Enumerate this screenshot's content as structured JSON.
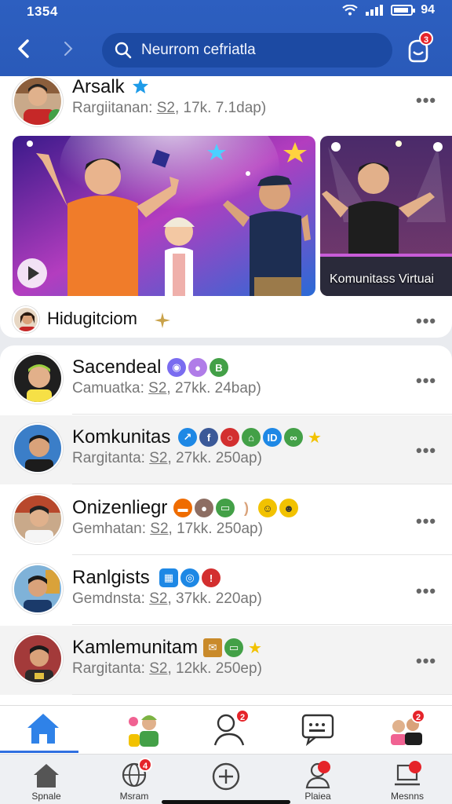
{
  "status": {
    "time": "1354",
    "battery": "94"
  },
  "header": {
    "search_text": "Neurrom cefriatla",
    "notif_count": "3"
  },
  "feed": {
    "title": "Arsalk",
    "meta_prefix": "Rargiitanan:",
    "meta_link": "S2",
    "meta_suffix": ", 17k. 7.1dap)",
    "caption2": "Komunitass Virtuai",
    "group_label": "Hidugitciom"
  },
  "list": [
    {
      "name": "Sacendeal",
      "prefix": "Camuatka:",
      "link": "S2",
      "suffix": ", 27kk. 24bap)"
    },
    {
      "name": "Komkunitas",
      "prefix": "Rargitanta:",
      "link": "S2",
      "suffix": ", 27kk. 250ap)"
    },
    {
      "name": "Onizenliegr",
      "prefix": "Gemhatan:",
      "link": "S2",
      "suffix": ", 17kk. 250ap)"
    },
    {
      "name": "Ranlgists",
      "prefix": "Gemdnsta:",
      "link": "S2",
      "suffix": ", 37kk. 220ap)"
    },
    {
      "name": "Kamlemunitam",
      "prefix": "Rargitanta:",
      "link": "S2",
      "suffix": ", 12kk. 250ep)"
    }
  ],
  "tabs": {
    "msg_badge": "2",
    "people_badge": "2"
  },
  "bottom_nav": {
    "home": "Spnale",
    "globe": "Msram",
    "globe_badge": "4",
    "profile": "Plaiea",
    "menu": "Mesnns"
  },
  "colors": {
    "accent": "#2f6fe0",
    "header": "#2d5fc0",
    "badge": "#e5242a"
  }
}
